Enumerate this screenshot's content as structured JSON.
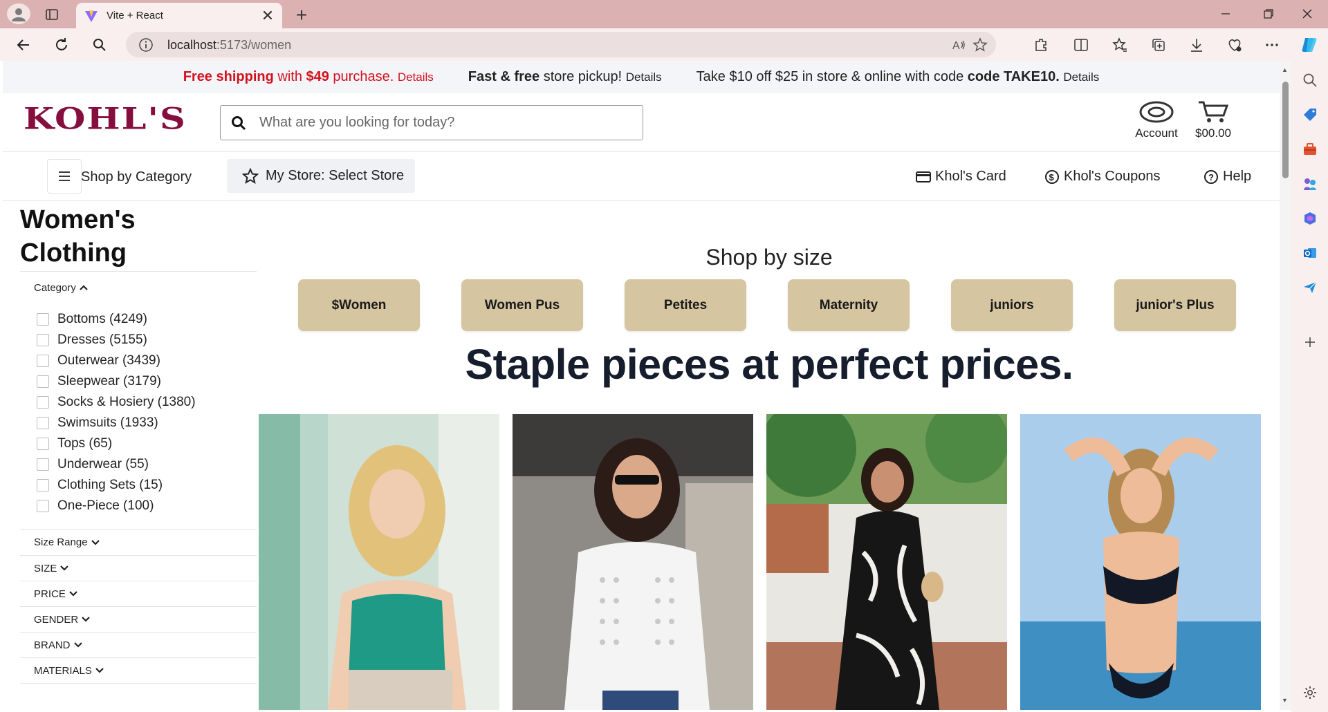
{
  "browser": {
    "tab_title": "Vite + React",
    "url_host": "localhost",
    "url_rest": ":5173/women",
    "icons": [
      "profile-icon",
      "tab-actions-icon",
      "vite-favicon",
      "close-icon",
      "plus-icon",
      "minimize-icon",
      "restore-icon",
      "close-window-icon",
      "back-icon",
      "refresh-icon",
      "search-icon",
      "info-icon",
      "read-aloud-icon",
      "favorite-star-icon",
      "extensions-icon",
      "split-screen-icon",
      "favorites-icon",
      "collections-icon",
      "downloads-icon",
      "performance-icon",
      "more-icon",
      "copilot-icon"
    ]
  },
  "promo": {
    "p1_bold": "Free shipping",
    "p1_mid": " with ",
    "p1_amount": "$49",
    "p1_end": " purchase.",
    "p1_details": "Details",
    "p2_bold": "Fast & free",
    "p2_rest": " store pickup!",
    "p2_details": "Details",
    "p3_text": "Take $10 off $25 in store & online with code ",
    "p3_code": "code TAKE10.",
    "p3_details": "Details"
  },
  "header": {
    "logo": "KOHL'S",
    "search_placeholder": "What are you looking for today?",
    "account_label": "Account",
    "cart_label": "$00.00"
  },
  "subnav": {
    "shop_by_category": "Shop by Category",
    "my_store": "My Store: Select Store",
    "card": "Khol's Card",
    "coupons": "Khol's Coupons",
    "help": "Help"
  },
  "filters": {
    "page_title": "Women's Clothing",
    "category_label": "Category",
    "categories": [
      {
        "label": "Bottoms (4249)"
      },
      {
        "label": "Dresses (5155)"
      },
      {
        "label": "Outerwear (3439)"
      },
      {
        "label": "Sleepwear (3179)"
      },
      {
        "label": "Socks & Hosiery (1380)"
      },
      {
        "label": "Swimsuits (1933)"
      },
      {
        "label": "Tops (65)"
      },
      {
        "label": "Underwear (55)"
      },
      {
        "label": "Clothing Sets (15)"
      },
      {
        "label": "One-Piece (100)"
      }
    ],
    "sections": [
      "Size Range",
      "SIZE",
      "PRICE",
      "GENDER",
      "BRAND",
      "MATERIALS"
    ]
  },
  "main": {
    "shop_by_size": "Shop by size",
    "sizes": [
      "$Women",
      "Women Pus",
      "Petites",
      "Maternity",
      "juniors",
      "junior's Plus"
    ],
    "headline": "Staple pieces at perfect prices."
  },
  "colors": {
    "brand": "#860e3f",
    "promo_red": "#d2111e",
    "size_button": "#d5c5a0",
    "chrome": "#dbb2b1"
  }
}
